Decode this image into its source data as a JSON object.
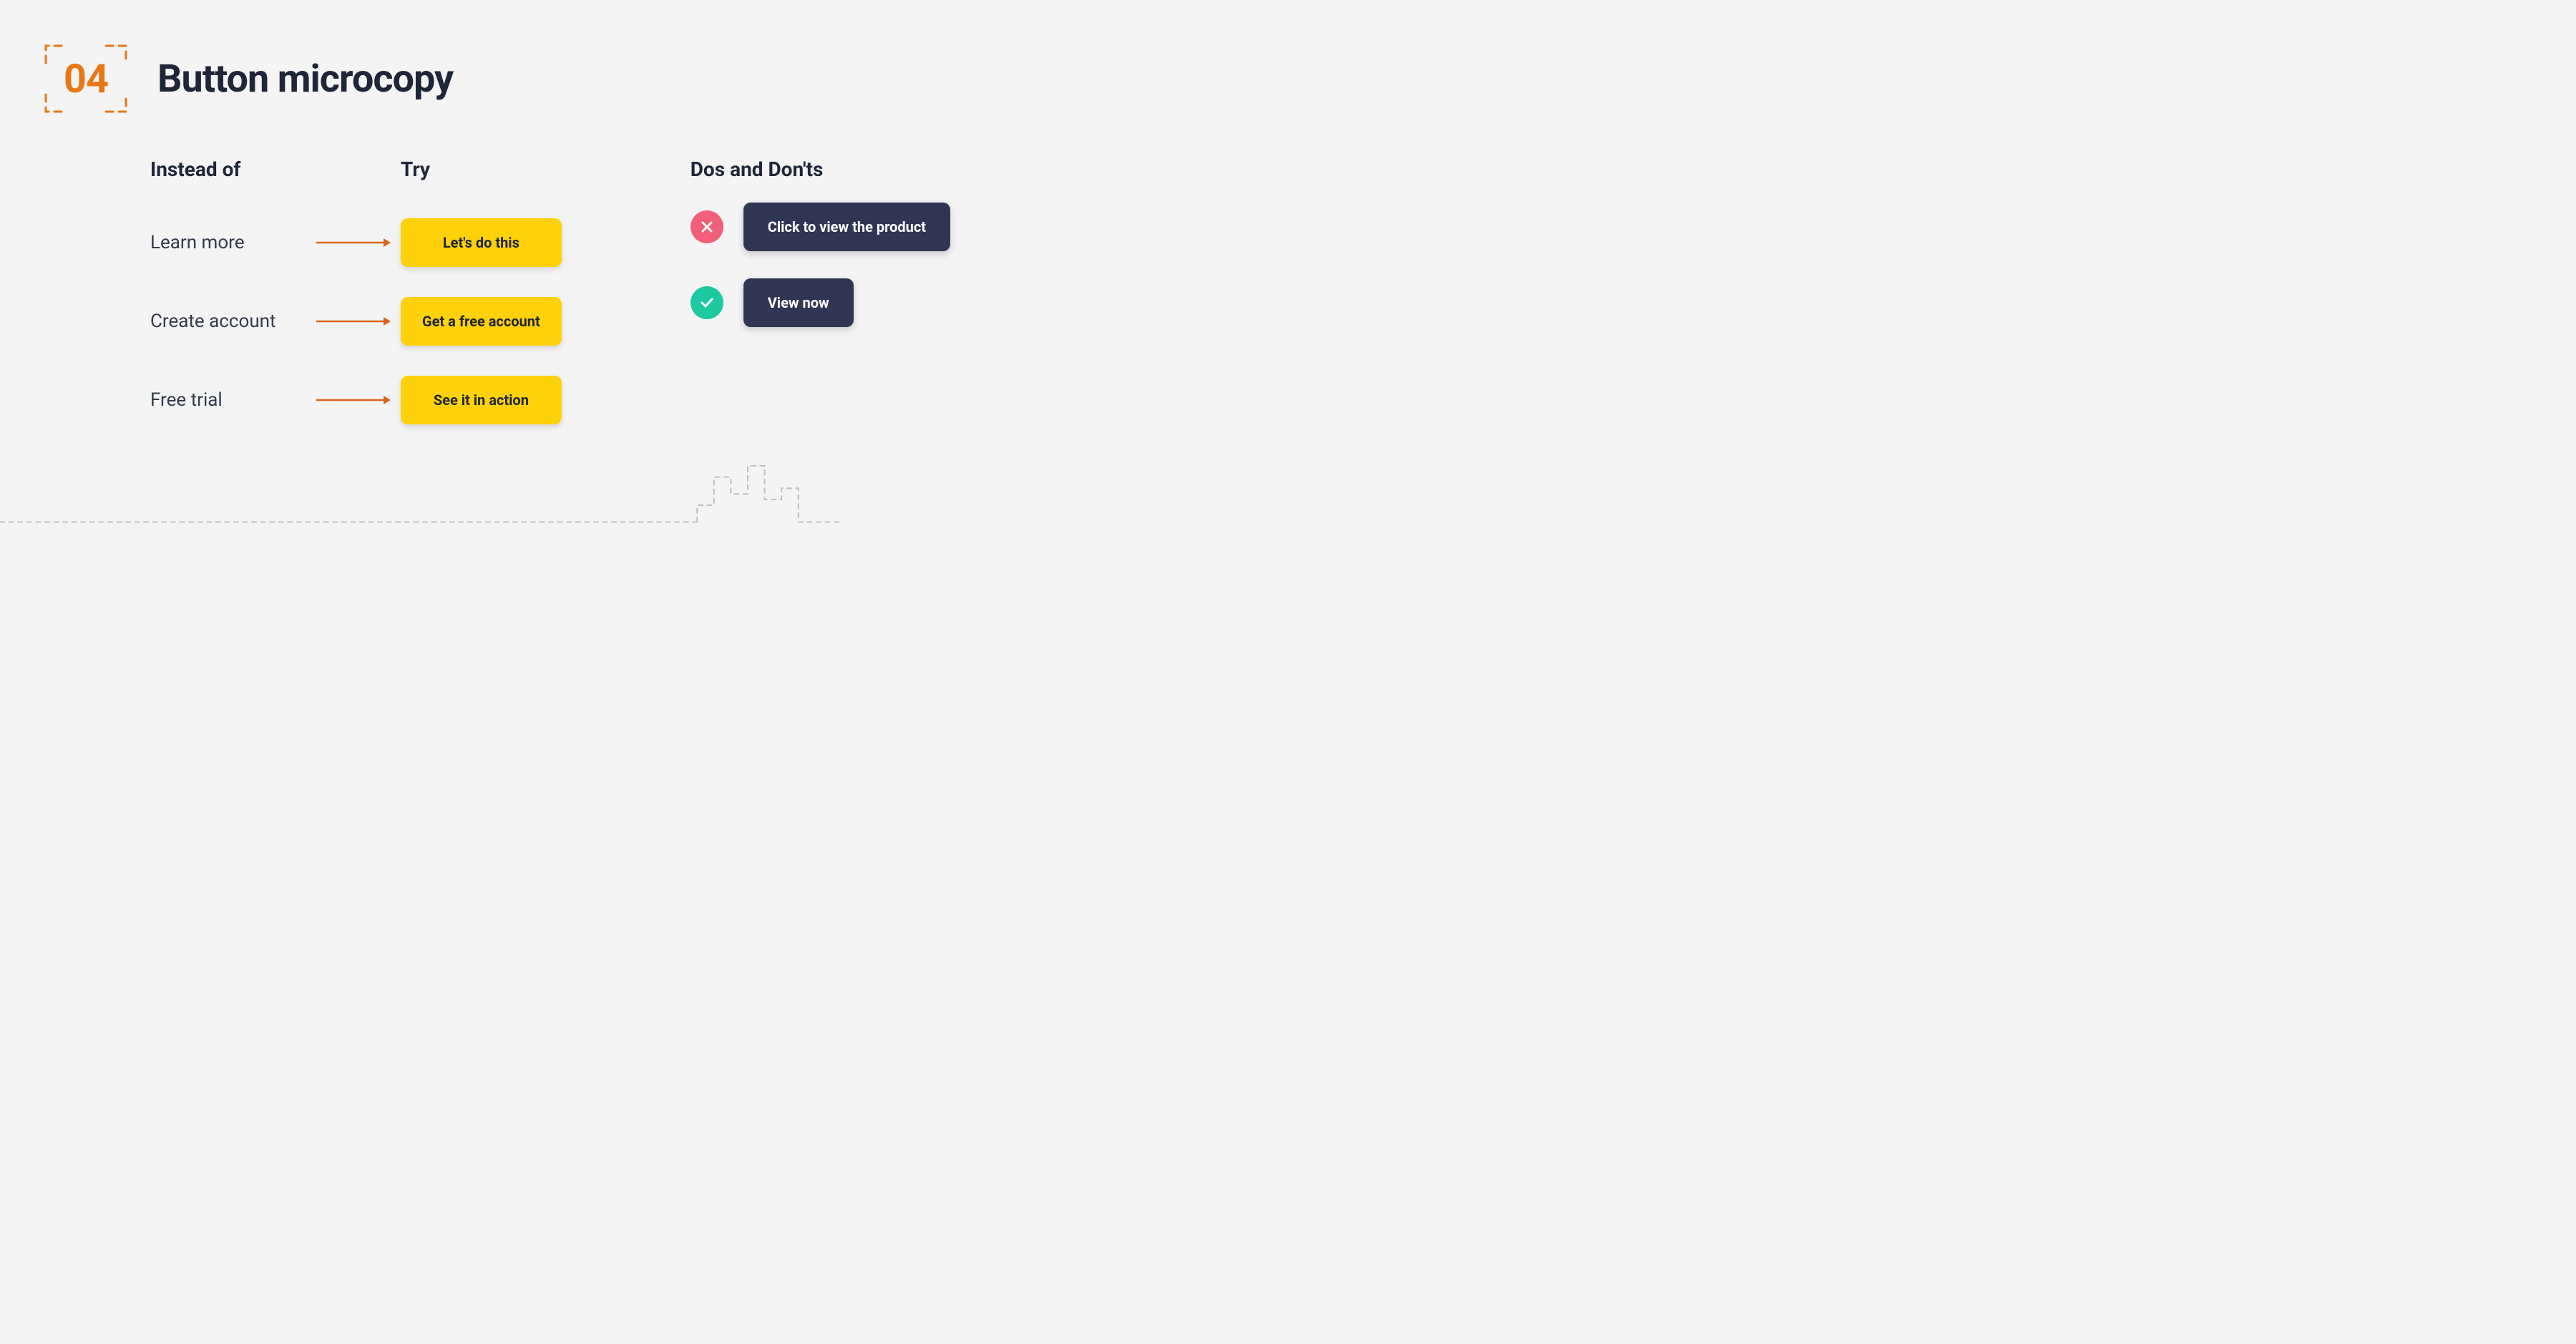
{
  "section": {
    "number": "04",
    "title": "Button microcopy"
  },
  "headers": {
    "instead": "Instead of",
    "try": "Try",
    "dosdonts": "Dos and Don'ts"
  },
  "rows": [
    {
      "instead": "Learn more",
      "try": "Let's do this"
    },
    {
      "instead": "Create account",
      "try": "Get a free account"
    },
    {
      "instead": "Free trial",
      "try": "See it in action"
    }
  ],
  "dosdonts": [
    {
      "status": "bad",
      "label": "Click to view the product"
    },
    {
      "status": "good",
      "label": "View now"
    }
  ],
  "colors": {
    "accent_orange": "#e77817",
    "button_yellow": "#ffd10a",
    "button_dark": "#2e3654",
    "badge_bad": "#f15f79",
    "badge_good": "#1dc9a0",
    "text_primary": "#1f2639",
    "bg": "#f4f4f4"
  }
}
